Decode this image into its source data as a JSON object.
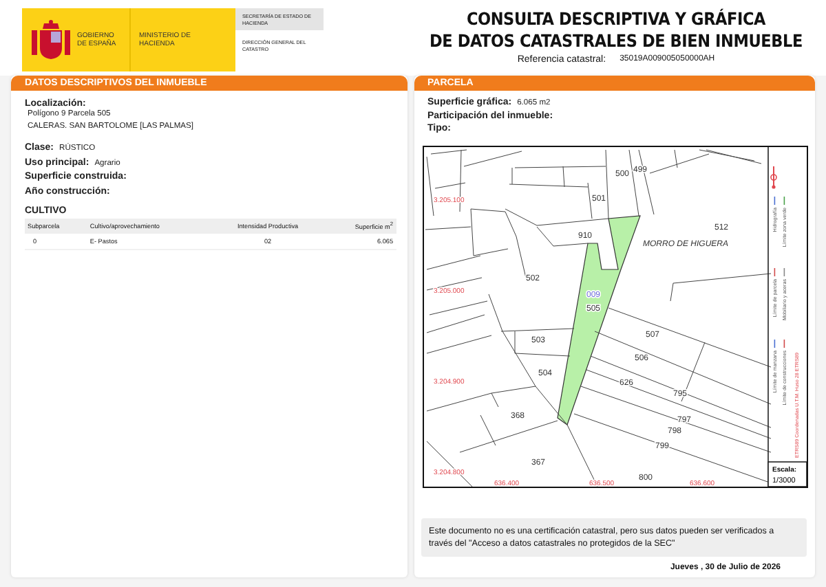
{
  "header": {
    "agency_lines": [
      "GOBIERNO DE ESPAÑA",
      "MINISTERIO DE HACIENDA"
    ],
    "secretariat": "SECRETARÍA DE ESTADO DE HACIENDA",
    "directorate": "DIRECCIÓN GENERAL DEL CATASTRO"
  },
  "title_lines": [
    "CONSULTA DESCRIPTIVA Y GRÁFICA",
    "DE DATOS CATASTRALES DE BIEN INMUEBLE"
  ],
  "reference": {
    "label": "Referencia catastral:",
    "value": "35019A009005050000AH"
  },
  "descriptive": {
    "title": "DATOS DESCRIPTIVOS DEL INMUEBLE",
    "location_label": "Localización:",
    "location_lines": [
      "Polígono 9 Parcela 505",
      "CALERAS. SAN BARTOLOME [LAS PALMAS]"
    ],
    "fields": [
      {
        "label": "Clase:",
        "value": "RÚSTICO"
      },
      {
        "label": "Uso principal:",
        "value": "Agrario"
      },
      {
        "label": "Superficie construida:"
      },
      {
        "label": "Año construcción:"
      }
    ],
    "cultivo": {
      "title": "CULTIVO",
      "columns": [
        "Subparcela",
        "Cultivo/aprovechamiento",
        "Intensidad Productiva",
        "Superficie m$^{2}$"
      ],
      "rows": [
        [
          "0",
          "E- Pastos",
          "02",
          "6.065"
        ]
      ]
    }
  },
  "parcel": {
    "title": "PARCELA",
    "fields": [
      {
        "label": "Superficie gráfica:",
        "value": "6.065 m2"
      },
      {
        "label": "Participación del inmueble:"
      },
      {
        "label": "Tipo:"
      }
    ],
    "map": {
      "labels": [
        {
          "text": "500",
          "kind": "parcel"
        },
        {
          "text": "499",
          "kind": "parcel"
        },
        {
          "text": "501",
          "kind": "parcel"
        },
        {
          "text": "512",
          "kind": "parcel"
        },
        {
          "text": "910",
          "kind": "parcel"
        },
        {
          "text": "MORRO DE HIGUERA",
          "kind": "place"
        },
        {
          "text": "502",
          "kind": "parcel"
        },
        {
          "text": "009",
          "kind": "highlight"
        },
        {
          "text": "505",
          "kind": "parcel"
        },
        {
          "text": "503",
          "kind": "parcel"
        },
        {
          "text": "507",
          "kind": "parcel"
        },
        {
          "text": "506",
          "kind": "parcel"
        },
        {
          "text": "504",
          "kind": "parcel"
        },
        {
          "text": "626",
          "kind": "parcel"
        },
        {
          "text": "795",
          "kind": "parcel"
        },
        {
          "text": "797",
          "kind": "parcel"
        },
        {
          "text": "798",
          "kind": "parcel"
        },
        {
          "text": "799",
          "kind": "parcel"
        },
        {
          "text": "368",
          "kind": "parcel"
        },
        {
          "text": "367",
          "kind": "parcel"
        },
        {
          "text": "800",
          "kind": "parcel"
        },
        {
          "text": "3.205.100",
          "kind": "coordinate"
        },
        {
          "text": "3.205.000",
          "kind": "coordinate"
        },
        {
          "text": "3.204.900",
          "kind": "coordinate"
        },
        {
          "text": "3.204.800",
          "kind": "coordinate"
        },
        {
          "text": "636.400",
          "kind": "coordinate"
        },
        {
          "text": "636.500",
          "kind": "coordinate"
        },
        {
          "text": "636.600",
          "kind": "coordinate"
        }
      ],
      "legend": [
        "Hidrografía",
        "Límite de parcela",
        "Límite de manzana",
        "Límite zona verde",
        "Mobiliario y aceras",
        "Límite de construcciones"
      ],
      "projection": "ETRS89 Coordenadas U.T.M. Huso 28 ETRS89",
      "scale_label": "Escala:",
      "scale": "1/3000"
    }
  },
  "note": "Este documento no es una certificación catastral, pero sus datos pueden ser verificados a través del \"Acceso a datos catastrales no protegidos de la SEC\"",
  "date": "Jueves , 30 de Julio de 2026"
}
